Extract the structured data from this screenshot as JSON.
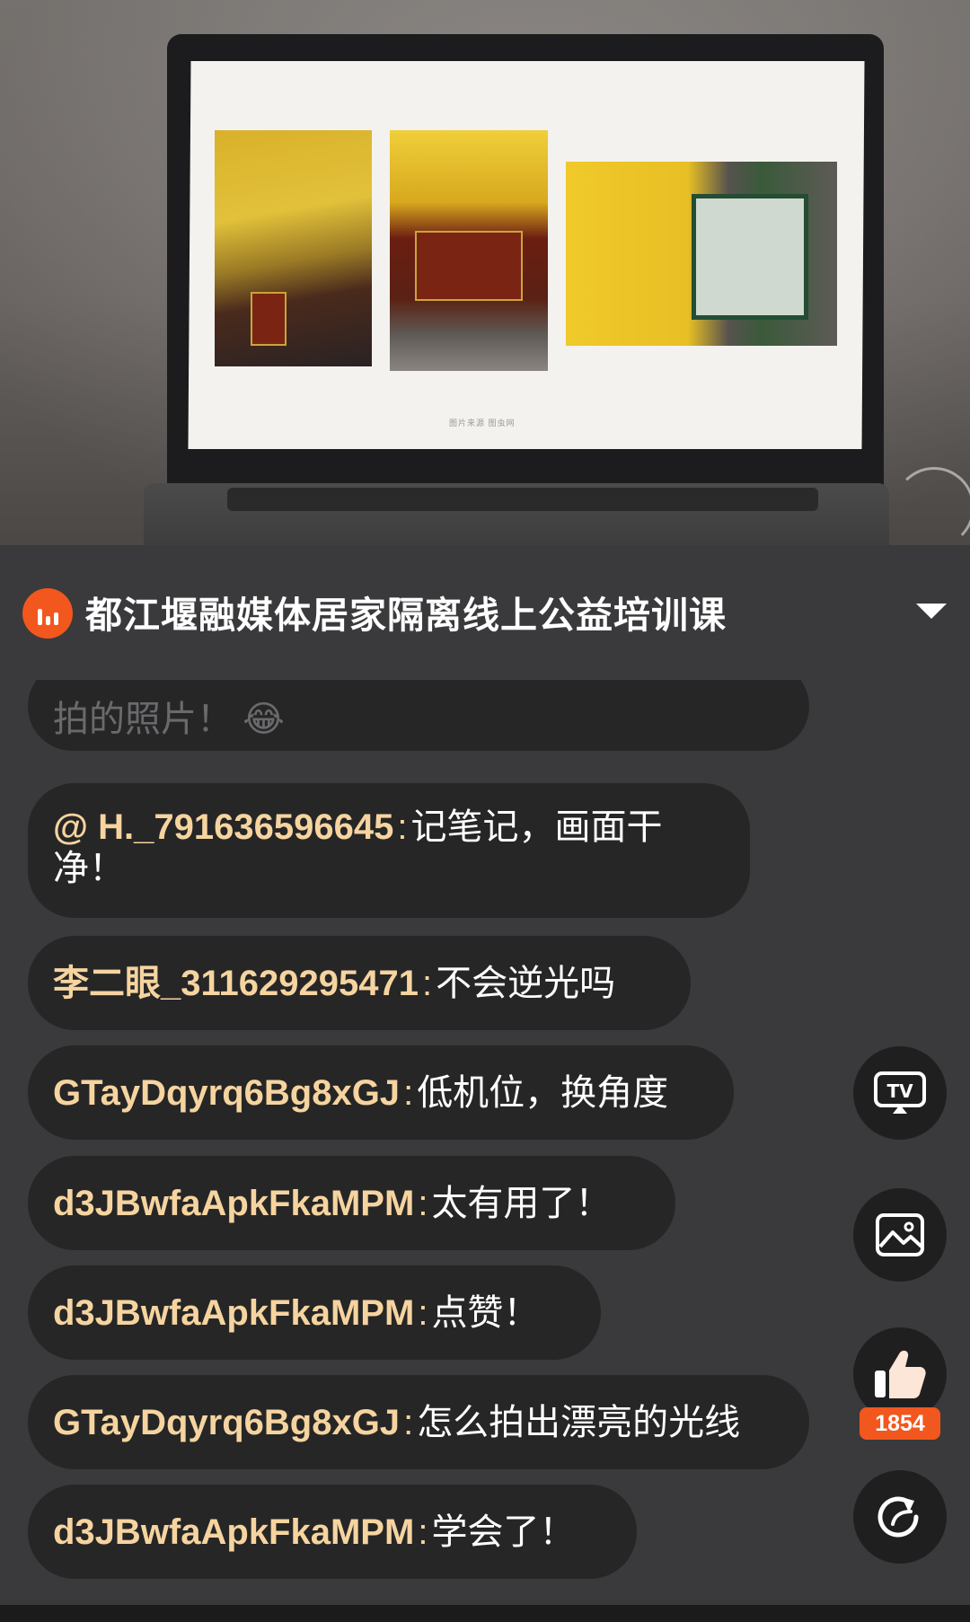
{
  "video": {
    "photo_caption": "图片来源  图虫网"
  },
  "header": {
    "title": "都江堰融媒体居家隔离线上公益培训课",
    "badge_icon": "live-bars-icon",
    "dropdown_icon": "triangle-down-icon",
    "badge_color": "#f2571e"
  },
  "comments": [
    {
      "user": "",
      "sep": "",
      "msg": "拍的照片！ 😂"
    },
    {
      "user": "@ H._791636596645",
      "sep": ":",
      "msg": "记笔记，画面干净！"
    },
    {
      "user": "李二眼_311629295471",
      "sep": ":",
      "msg": "不会逆光吗"
    },
    {
      "user": "GTayDqyrq6Bg8xGJ",
      "sep": ":",
      "msg": "低机位，换角度"
    },
    {
      "user": "d3JBwfaApkFkaMPM",
      "sep": ":",
      "msg": "太有用了！"
    },
    {
      "user": "d3JBwfaApkFkaMPM",
      "sep": ":",
      "msg": "点赞！"
    },
    {
      "user": "GTayDqyrq6Bg8xGJ",
      "sep": ":",
      "msg": "怎么拍出漂亮的光线"
    },
    {
      "user": "d3JBwfaApkFkaMPM",
      "sep": ":",
      "msg": "学会了！"
    }
  ],
  "side_buttons": {
    "tv_icon": "tv-cast-icon",
    "image_icon": "image-icon",
    "like_icon": "thumbs-up-icon",
    "share_icon": "share-arrow-icon",
    "like_count": "1854"
  },
  "colors": {
    "background": "#3a3a3c",
    "bubble": "#262627",
    "username": "#f6d49f",
    "accent": "#f2571e"
  }
}
